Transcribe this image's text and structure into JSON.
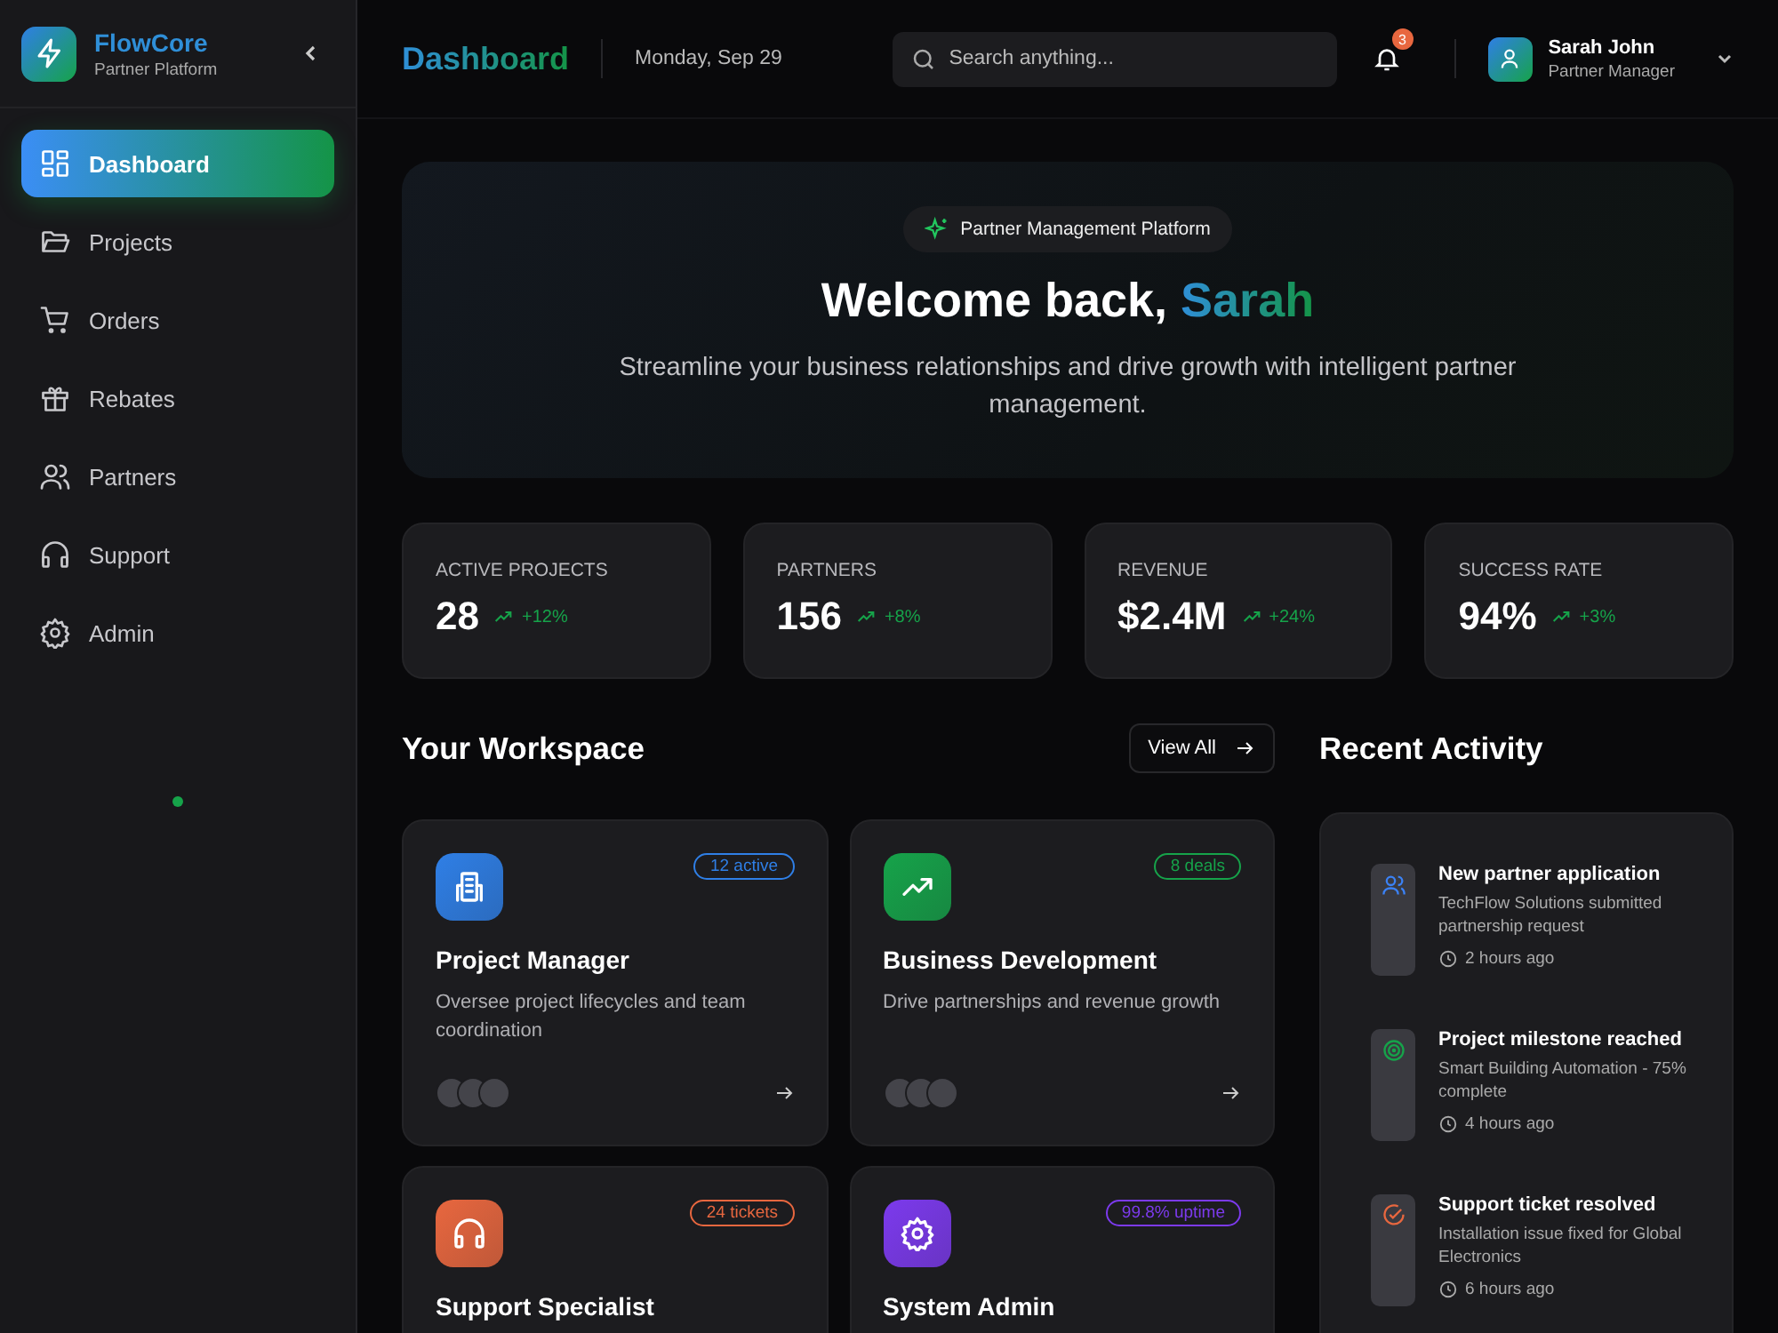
{
  "brand": {
    "name": "FlowCore",
    "tagline": "Partner Platform"
  },
  "nav": [
    {
      "label": "Dashboard",
      "kind": "grid",
      "selected": true
    },
    {
      "label": "Projects",
      "kind": "folder",
      "selected": false
    },
    {
      "label": "Orders",
      "kind": "cart",
      "selected": false
    },
    {
      "label": "Rebates",
      "kind": "gift",
      "selected": false
    },
    {
      "label": "Partners",
      "kind": "users",
      "selected": false
    },
    {
      "label": "Support",
      "kind": "headset",
      "selected": false
    },
    {
      "label": "Admin",
      "kind": "gear",
      "selected": false
    }
  ],
  "header": {
    "title": "Dashboard",
    "date": "Monday, Sep 29",
    "search": {
      "placeholder": "Search anything..."
    },
    "notifications": "3",
    "user": {
      "name": "Sarah John",
      "role": "Partner Manager"
    }
  },
  "hero": {
    "badge": "Partner Management Platform",
    "title": "Welcome back,",
    "name": "Sarah",
    "subtitle": "Streamline your business relationships and drive growth with intelligent partner management."
  },
  "stats": [
    {
      "label": "ACTIVE PROJECTS",
      "value": "28",
      "change": "+12%"
    },
    {
      "label": "PARTNERS",
      "value": "156",
      "change": "+8%"
    },
    {
      "label": "REVENUE",
      "value": "$2.4M",
      "change": "+24%"
    },
    {
      "label": "SUCCESS RATE",
      "value": "94%",
      "change": "+3%"
    }
  ],
  "workspace": {
    "title": "Your Workspace",
    "button": "View All",
    "cards": [
      {
        "title": "Project Manager",
        "description": "Oversee project lifecycles and team coordination",
        "badge": "12 active",
        "kind": "building",
        "color": "#2f7fe6"
      },
      {
        "title": "Business Development",
        "description": "Drive partnerships and revenue growth",
        "badge": "8 deals",
        "kind": "trend",
        "color": "#16a34a"
      },
      {
        "title": "Support Specialist",
        "badge": "24 tickets",
        "kind": "headset",
        "color": "#e8673f"
      },
      {
        "title": "System Admin",
        "badge": "99.8% uptime",
        "kind": "gear",
        "color": "#7c3aed"
      }
    ]
  },
  "activity": {
    "title": "Recent Activity",
    "items": [
      {
        "title": "New partner application",
        "detail": "TechFlow Solutions submitted partnership request",
        "time": "2 hours ago",
        "kind": "users",
        "color": "#3b82f6"
      },
      {
        "title": "Project milestone reached",
        "detail": "Smart Building Automation - 75% complete",
        "time": "4 hours ago",
        "kind": "target",
        "color": "#16a34a"
      },
      {
        "title": "Support ticket resolved",
        "detail": "Installation issue fixed for Global Electronics",
        "time": "6 hours ago",
        "kind": "check",
        "color": "#e8673f"
      }
    ]
  }
}
